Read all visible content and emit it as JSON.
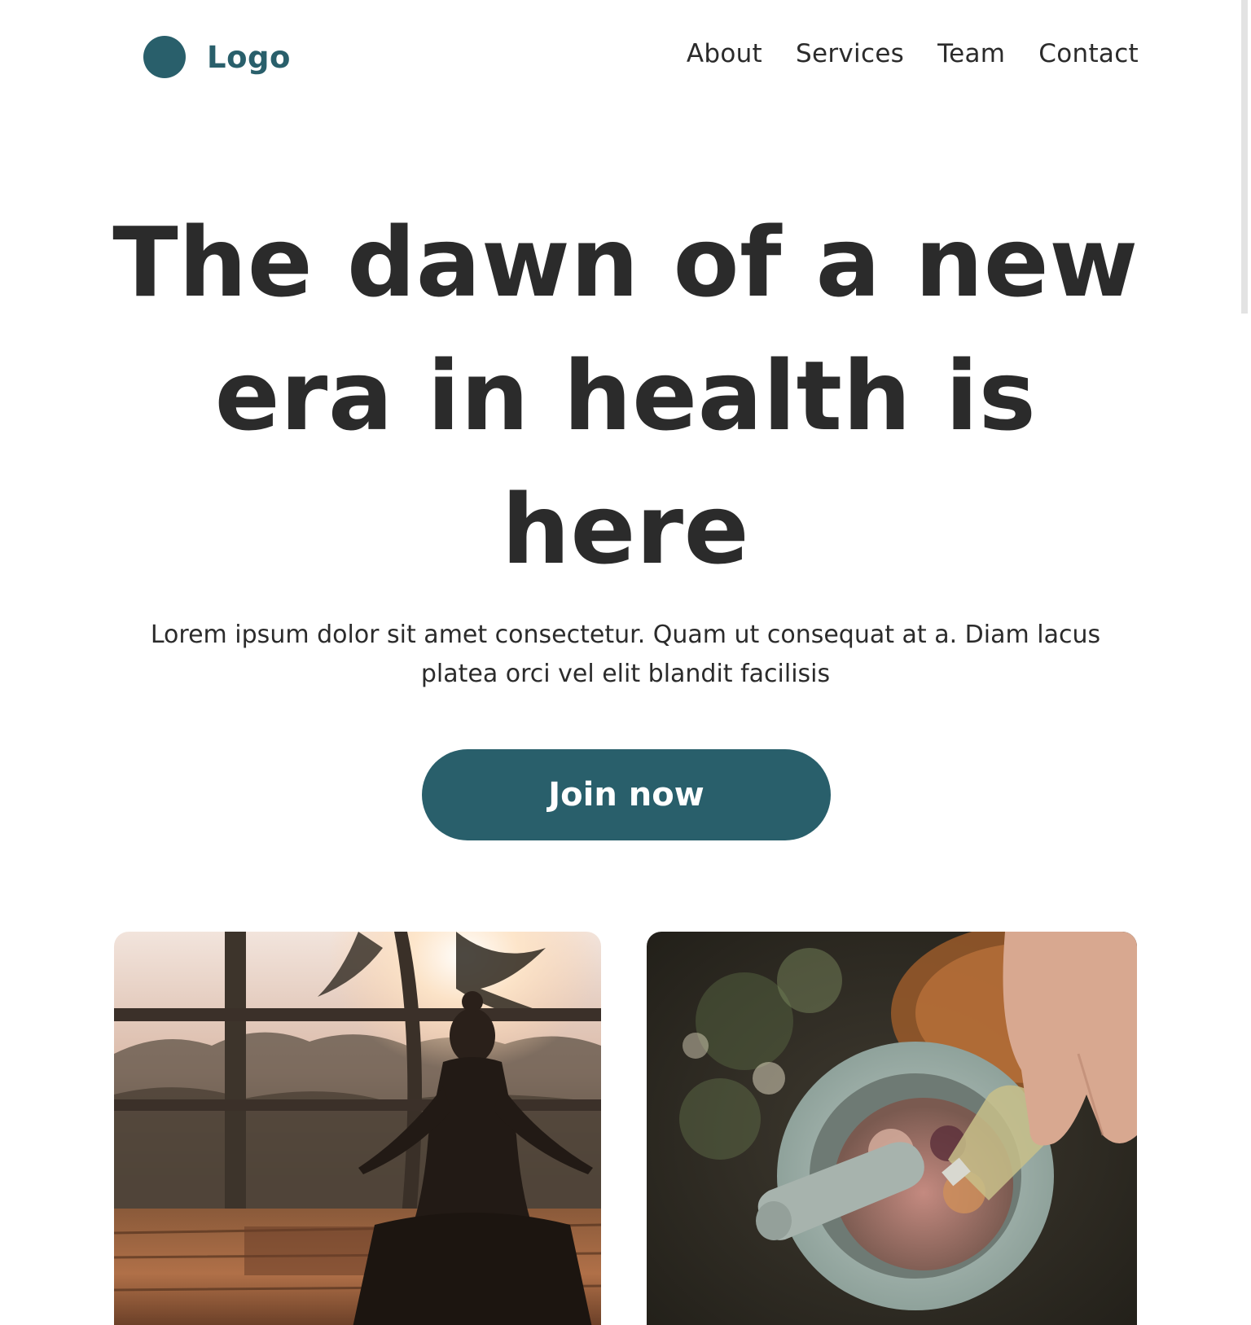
{
  "colors": {
    "brand": "#295f6b",
    "text": "#2b2b2b",
    "background": "#ffffff"
  },
  "header": {
    "logo_icon": "circle-logo-mark",
    "logo_text": "Logo",
    "nav": [
      {
        "label": "About"
      },
      {
        "label": "Services"
      },
      {
        "label": "Team"
      },
      {
        "label": "Contact"
      }
    ]
  },
  "hero": {
    "title_line1": "The dawn of a new",
    "title_line2": "era in health is",
    "title_line3": "here",
    "subtitle_line1": "Lorem ipsum dolor sit amet consectetur. Quam ut consequat at a. Diam lacus",
    "subtitle_line2": "platea orci vel elit blandit facilisis",
    "cta_label": "Join now"
  },
  "images": [
    {
      "subject": "yoga-meditation-sunset-photo"
    },
    {
      "subject": "mortar-pestle-herbal-oil-photo"
    }
  ]
}
